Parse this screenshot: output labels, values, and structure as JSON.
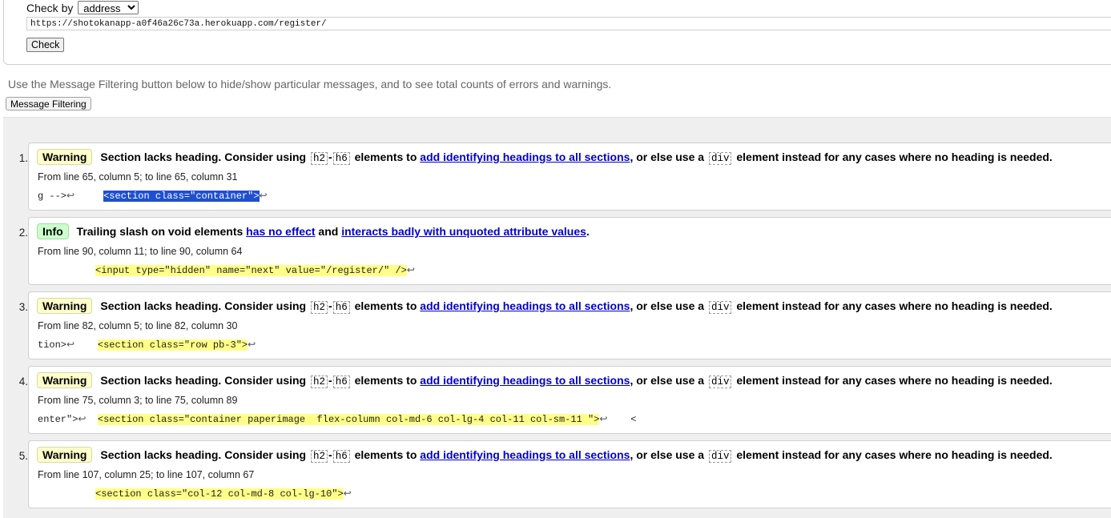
{
  "form": {
    "checkby_label": "Check by",
    "checkby_selected": "address",
    "url": "https://shotokanapp-a0f46a26c73a.herokuapp.com/register/",
    "check_button": "Check"
  },
  "hint": "Use the Message Filtering button below to hide/show particular messages, and to see total counts of errors and warnings.",
  "filter_button": "Message Filtering",
  "messages": [
    {
      "num": "1.",
      "type": "Warning",
      "parts": [
        "Section lacks heading. Consider using",
        "h2",
        "-",
        "h6",
        "elements to",
        "add identifying headings to all sections",
        ", or else use a",
        "div",
        "element instead for any cases where no heading is needed."
      ],
      "location": "From line 65, column 5; to line 65, column 31",
      "extract_pre": "g -->",
      "extract_mark": "<section class=\"container\">",
      "extract_post": ""
    },
    {
      "num": "2.",
      "type": "Info",
      "parts": [
        "Trailing slash on void elements",
        "has no effect",
        "and",
        "interacts badly with unquoted attribute values",
        "."
      ],
      "location": "From line 90, column 11; to line 90, column 64",
      "extract_pre": "",
      "extract_mark": "<input type=\"hidden\" name=\"next\" value=\"/register/\" />",
      "extract_post": ""
    },
    {
      "num": "3.",
      "type": "Warning",
      "parts": [
        "Section lacks heading. Consider using",
        "h2",
        "-",
        "h6",
        "elements to",
        "add identifying headings to all sections",
        ", or else use a",
        "div",
        "element instead for any cases where no heading is needed."
      ],
      "location": "From line 82, column 5; to line 82, column 30",
      "extract_pre": "tion>",
      "extract_mark": "<section class=\"row pb-3\">",
      "extract_post": ""
    },
    {
      "num": "4.",
      "type": "Warning",
      "parts": [
        "Section lacks heading. Consider using",
        "h2",
        "-",
        "h6",
        "elements to",
        "add identifying headings to all sections",
        ", or else use a",
        "div",
        "element instead for any cases where no heading is needed."
      ],
      "location": "From line 75, column 3; to line 75, column 89",
      "extract_pre": "enter\">",
      "extract_mark": "<section class=\"container paperimage  flex-column col-md-6 col-lg-4 col-11 col-sm-11 \">",
      "extract_post": "<"
    },
    {
      "num": "5.",
      "type": "Warning",
      "parts": [
        "Section lacks heading. Consider using",
        "h2",
        "-",
        "h6",
        "elements to",
        "add identifying headings to all sections",
        ", or else use a",
        "div",
        "element instead for any cases where no heading is needed."
      ],
      "location": "From line 107, column 25; to line 107, column 67",
      "extract_pre": "",
      "extract_mark": "<section class=\"col-12 col-md-8 col-lg-10\">",
      "extract_post": ""
    }
  ]
}
